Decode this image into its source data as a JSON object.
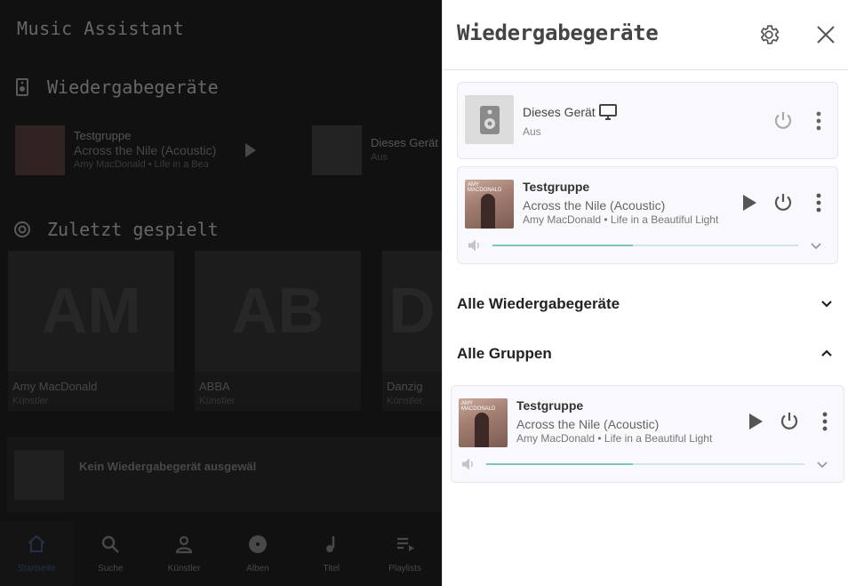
{
  "background": {
    "app_title": "Music Assistant",
    "players_section": "Wiedergabegeräte",
    "recent_section": "Zuletzt gespielt",
    "players": [
      {
        "name": "Testgruppe",
        "track": "Across the Nile (Acoustic)",
        "artist_album": "Amy MacDonald • Life in a Bea"
      },
      {
        "name": "Dieses Gerät",
        "status": "Aus"
      }
    ],
    "recent": [
      {
        "initials": "AM",
        "name": "Amy MacDonald",
        "kind": "Künstler"
      },
      {
        "initials": "AB",
        "name": "ABBA",
        "kind": "Künstler"
      },
      {
        "initials": "D",
        "name": "Danzig",
        "kind": "Künstler"
      }
    ],
    "now_playing_text": "Kein Wiedergabegerät ausgewäl",
    "nav": [
      {
        "label": "Startseite",
        "icon": "home-icon",
        "active": true
      },
      {
        "label": "Suche",
        "icon": "search-icon",
        "active": false
      },
      {
        "label": "Künstler",
        "icon": "person-icon",
        "active": false
      },
      {
        "label": "Alben",
        "icon": "album-icon",
        "active": false
      },
      {
        "label": "Titel",
        "icon": "music-note-icon",
        "active": false
      },
      {
        "label": "Playlists",
        "icon": "playlist-icon",
        "active": false
      }
    ]
  },
  "drawer": {
    "title": "Wiedergabegeräte",
    "settings_icon": "gear-icon",
    "close_icon": "close-icon",
    "players": [
      {
        "name": "Dieses Gerät",
        "status": "Aus",
        "device_icon": "monitor-icon",
        "thumb_icon": "speaker-icon"
      },
      {
        "name": "Testgruppe",
        "track": "Across the Nile (Acoustic)",
        "artist_album": "Amy MacDonald • Life in a Beautiful Light",
        "album_cover_text": "AMY MACDONALD",
        "volume": 0.46
      }
    ],
    "sections": [
      {
        "label": "Alle Wiedergabegeräte",
        "expanded": false
      },
      {
        "label": "Alle Gruppen",
        "expanded": true
      }
    ],
    "group_player": {
      "name": "Testgruppe",
      "track": "Across the Nile (Acoustic)",
      "artist_album": "Amy MacDonald • Life in a Beautiful Light",
      "album_cover_text": "AMY MACDONALD",
      "volume": 0.46
    },
    "colors": {
      "accent": "#7cc5bb",
      "accent_light": "#cfe8e4",
      "card_bg": "#f8f8fd"
    }
  }
}
